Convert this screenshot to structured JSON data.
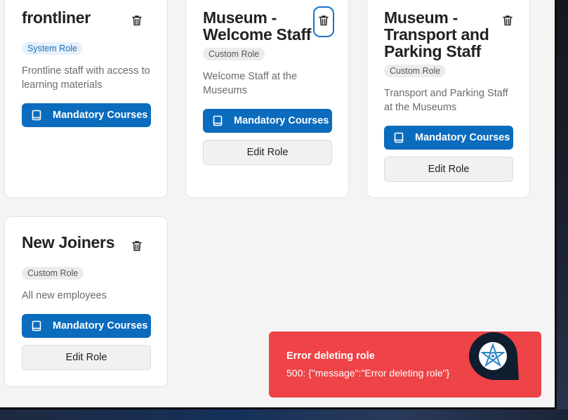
{
  "cards": [
    {
      "title": "frontliner",
      "badge": "System Role",
      "description": "Frontline staff with access to learning materials",
      "primary_button": "Mandatory Courses"
    },
    {
      "title": "Museum - Welcome Staff",
      "badge": "Custom Role",
      "description": "Welcome Staff at the Museums",
      "primary_button": "Mandatory Courses",
      "secondary_button": "Edit Role"
    },
    {
      "title": "Museum - Transport and Parking Staff",
      "badge": "Custom Role",
      "description": "Transport and Parking Staff at the Museums",
      "primary_button": "Mandatory Courses",
      "secondary_button": "Edit Role"
    },
    {
      "title": "New Joiners",
      "badge": "Custom Role",
      "description": "All new employees",
      "primary_button": "Mandatory Courses",
      "secondary_button": "Edit Role"
    }
  ],
  "toast": {
    "title": "Error deleting role",
    "message": "500: {\"message\":\"Error deleting role\"}",
    "color": "#ee4347"
  },
  "icons": {
    "delete": "trash-icon",
    "courses": "book-icon",
    "chat": "support-chat-icon"
  },
  "colors": {
    "primary": "#0b6cbe",
    "system_badge_bg": "#e6f1fb",
    "focus_ring": "#1a73c9"
  }
}
